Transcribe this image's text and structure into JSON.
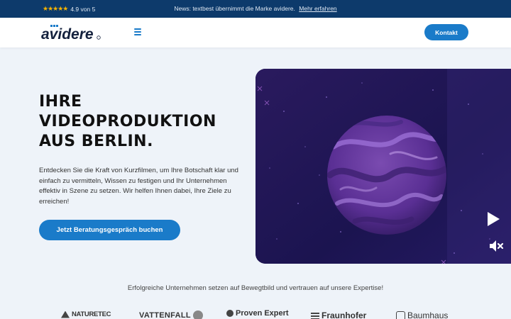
{
  "topbar": {
    "stars": "★★★★★",
    "rating": "4.9 von 5",
    "news_text": "News: textbest übernimmt die Marke avidere.",
    "news_link": "Mehr erfahren"
  },
  "header": {
    "logo_text": "avidere",
    "contact_label": "Kontakt"
  },
  "hero": {
    "title_lines": [
      "IHRE",
      "VIDEOPRODUKTION",
      "AUS BERLIN."
    ],
    "text": "Entdecken Sie die Kraft von Kurzfilmen, um Ihre Botschaft klar und einfach zu vermitteln, Wissen zu festigen und Ihr Unternehmen effektiv in Szene zu setzen. Wir helfen Ihnen dabei, Ihre Ziele zu erreichen!",
    "cta_label": "Jetzt Beratungsgespräch buchen"
  },
  "partners": {
    "text": "Erfolgreiche Unternehmen setzen auf Bewegtbild und vertrauen auf unsere Expertise!",
    "logos": [
      "NATURETEC",
      "VATTENFALL",
      "Proven Expert",
      "Fraunhofer",
      "Baumhaus"
    ]
  },
  "colors": {
    "accent": "#1a7bc9",
    "topbar_bg": "#0d3a6b",
    "page_bg": "#eef3f9",
    "video_bg": "#1c1550"
  }
}
